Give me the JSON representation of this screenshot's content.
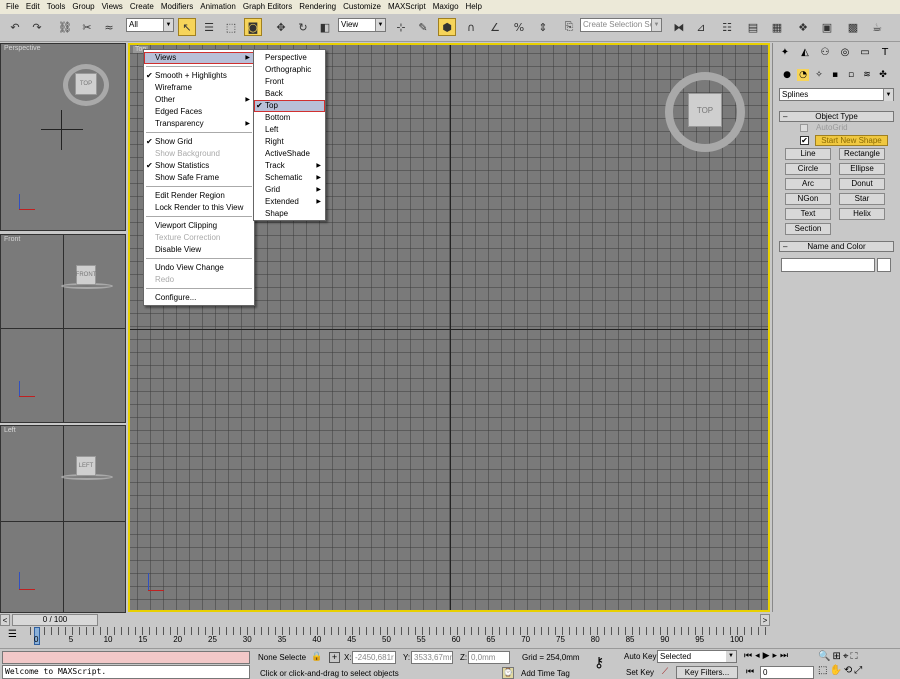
{
  "menubar": [
    "File",
    "Edit",
    "Tools",
    "Group",
    "Views",
    "Create",
    "Modifiers",
    "Animation",
    "Graph Editors",
    "Rendering",
    "Customize",
    "MAXScript",
    "Maxigo",
    "Help"
  ],
  "toolbar": {
    "selection_filter": "All",
    "ref_coord": "View",
    "named_selection_placeholder": "Create Selection Set"
  },
  "viewports": {
    "perspective": "Perspective",
    "front": "Front",
    "left": "Left",
    "top": "Top"
  },
  "viewcube": {
    "top_label": "TOP",
    "front_label": "FRONT",
    "left_label": "LEFT"
  },
  "viewport_menu": {
    "items": [
      {
        "label": "Views",
        "submenu": true,
        "highlight": true
      },
      {
        "label": "Smooth + Highlights",
        "checked": true
      },
      {
        "label": "Wireframe"
      },
      {
        "label": "Other",
        "submenu": true
      },
      {
        "label": "Edged Faces"
      },
      {
        "label": "Transparency",
        "submenu": true
      },
      {
        "label": "Show Grid",
        "checked": true
      },
      {
        "label": "Show Background",
        "disabled": true
      },
      {
        "label": "Show Statistics",
        "checked": true
      },
      {
        "label": "Show Safe Frame"
      },
      {
        "label": "Edit Render Region"
      },
      {
        "label": "Lock Render to this View"
      },
      {
        "label": "Viewport Clipping"
      },
      {
        "label": "Texture Correction",
        "disabled": true
      },
      {
        "label": "Disable View"
      },
      {
        "label": "Undo View Change"
      },
      {
        "label": "Redo",
        "disabled": true
      },
      {
        "label": "Configure..."
      }
    ]
  },
  "views_submenu": {
    "items": [
      {
        "label": "Perspective"
      },
      {
        "label": "Orthographic"
      },
      {
        "label": "Front"
      },
      {
        "label": "Back"
      },
      {
        "label": "Top",
        "checked": true,
        "highlight": true
      },
      {
        "label": "Bottom"
      },
      {
        "label": "Left"
      },
      {
        "label": "Right"
      },
      {
        "label": "ActiveShade"
      },
      {
        "label": "Track",
        "submenu": true
      },
      {
        "label": "Schematic",
        "submenu": true
      },
      {
        "label": "Grid",
        "submenu": true
      },
      {
        "label": "Extended",
        "submenu": true
      },
      {
        "label": "Shape"
      }
    ]
  },
  "command_panel": {
    "category": "Splines",
    "object_type_title": "Object Type",
    "autogrid": "AutoGrid",
    "start_new_shape": "Start New Shape",
    "buttons": [
      "Line",
      "Rectangle",
      "Circle",
      "Ellipse",
      "Arc",
      "Donut",
      "NGon",
      "Star",
      "Text",
      "Helix",
      "Section"
    ],
    "name_color_title": "Name and Color",
    "name_value": ""
  },
  "timeline": {
    "frame_display": "0 / 100",
    "ticks": [
      "0",
      "5",
      "10",
      "15",
      "20",
      "25",
      "30",
      "35",
      "40",
      "45",
      "50",
      "55",
      "60",
      "65",
      "70",
      "75",
      "80",
      "85",
      "90",
      "95",
      "100"
    ]
  },
  "status": {
    "maxscript": "Welcome to MAXScript.",
    "selection": "None Selecte",
    "x_label": "X:",
    "x_value": "-2450,681r",
    "y_label": "Y:",
    "y_value": "3533,67mm",
    "z_label": "Z:",
    "z_value": "0,0mm",
    "grid": "Grid = 254,0mm",
    "prompt": "Click or click-and-drag to select objects",
    "add_time_tag": "Add Time Tag",
    "auto_key": "Auto Key",
    "set_key": "Set Key",
    "key_mode": "Selected",
    "key_filters": "Key Filters...",
    "current_frame": "0"
  }
}
